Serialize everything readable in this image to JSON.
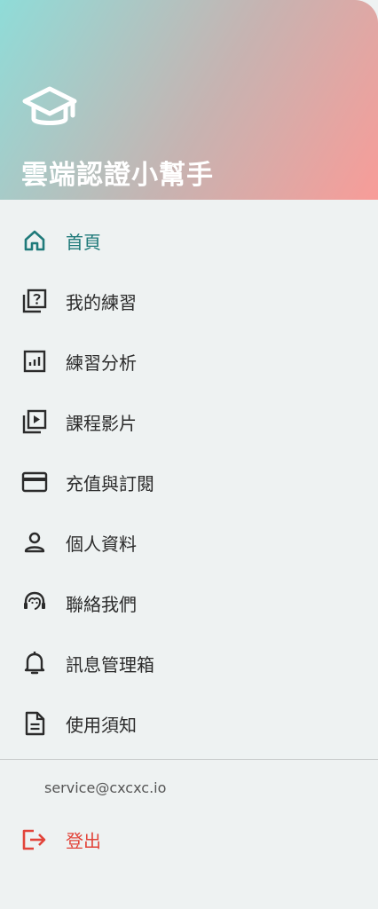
{
  "header": {
    "app_title": "雲端認證小幫手",
    "logo_icon": "graduation-cap-icon",
    "colors": {
      "gradient_start": "#8fdcd8",
      "gradient_end": "#f89c98"
    }
  },
  "menu": {
    "active_color": "#1f7a7a",
    "items": [
      {
        "label": "首頁",
        "icon": "home-icon",
        "active": true
      },
      {
        "label": "我的練習",
        "icon": "quiz-icon",
        "active": false
      },
      {
        "label": "練習分析",
        "icon": "analytics-icon",
        "active": false
      },
      {
        "label": "課程影片",
        "icon": "video-library-icon",
        "active": false
      },
      {
        "label": "充值與訂閱",
        "icon": "credit-card-icon",
        "active": false
      },
      {
        "label": "個人資料",
        "icon": "person-icon",
        "active": false
      },
      {
        "label": "聯絡我們",
        "icon": "support-agent-icon",
        "active": false
      },
      {
        "label": "訊息管理箱",
        "icon": "bell-icon",
        "active": false
      },
      {
        "label": "使用須知",
        "icon": "document-icon",
        "active": false
      }
    ]
  },
  "footer": {
    "email": "service@cxcxc.io",
    "logout_label": "登出",
    "logout_icon": "logout-icon",
    "logout_color": "#e2443a"
  }
}
